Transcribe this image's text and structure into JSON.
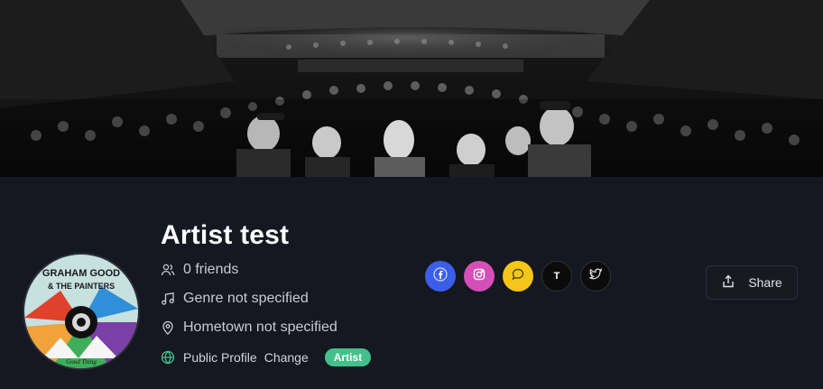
{
  "profile": {
    "name": "Artist test",
    "friends": "0 friends",
    "genre": "Genre not specified",
    "hometown": "Hometown not specified",
    "visibility": "Public Profile",
    "change_label": "Change",
    "badge": "Artist"
  },
  "avatar": {
    "logo_line1": "GRAHAM GOOD",
    "logo_line2": "& THE PAINTERS",
    "logo_footer": "Good Thing"
  },
  "socials": [
    {
      "name": "facebook",
      "glyph": "f",
      "color": "#3b5ee8"
    },
    {
      "name": "instagram",
      "color": "#d44fb8"
    },
    {
      "name": "chat",
      "color": "#f5c518"
    },
    {
      "name": "tiktok",
      "glyph": "T",
      "color": "#0b0b0b"
    },
    {
      "name": "twitter",
      "color": "#0b0b0b"
    }
  ],
  "actions": {
    "share_label": "Share"
  },
  "colors": {
    "badge": "#43c08c",
    "background": "#151820"
  }
}
